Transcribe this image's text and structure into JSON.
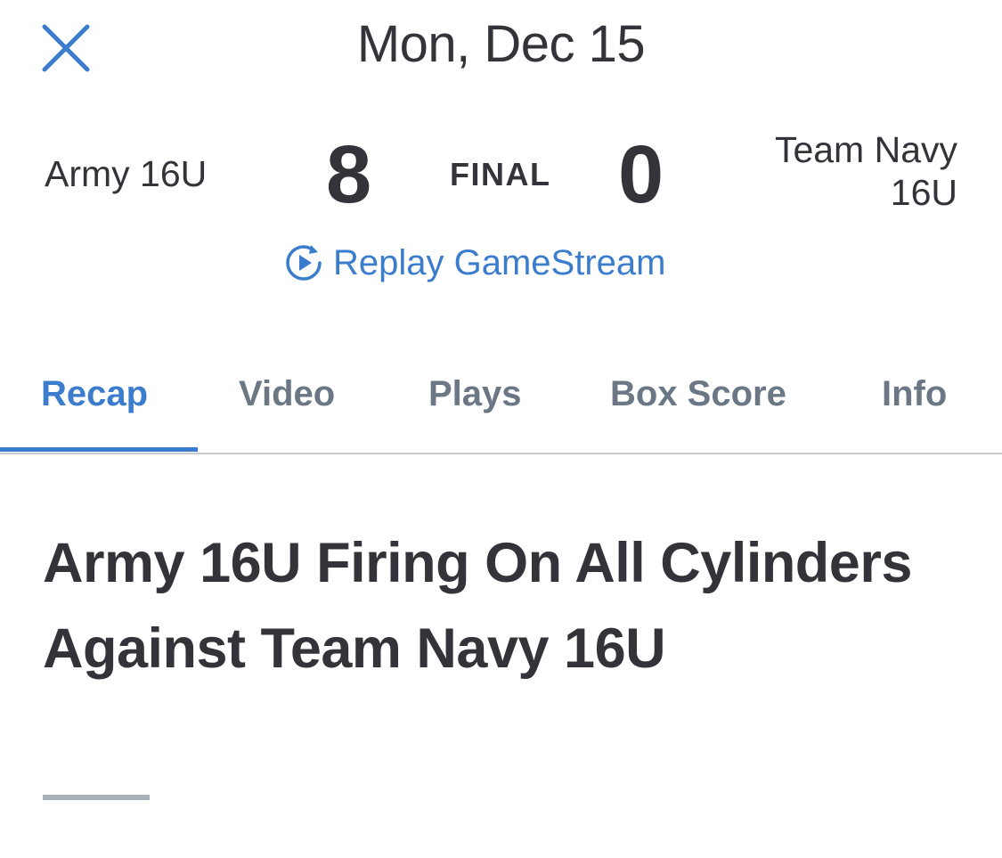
{
  "header": {
    "date": "Mon, Dec 15",
    "close_icon": "close-icon"
  },
  "scoreboard": {
    "home_team": "Army 16U",
    "home_score": "8",
    "status": "FINAL",
    "away_score": "0",
    "away_team_line1": "Team Navy",
    "away_team_line2": "16U"
  },
  "replay": {
    "icon": "replay-play-icon",
    "label": "Replay GameStream"
  },
  "tabs": [
    {
      "label": "Recap",
      "active": true
    },
    {
      "label": "Video",
      "active": false
    },
    {
      "label": "Plays",
      "active": false
    },
    {
      "label": "Box Score",
      "active": false
    },
    {
      "label": "Info",
      "active": false
    }
  ],
  "article": {
    "headline": "Army 16U Firing On All Cylinders Against Team Navy 16U"
  },
  "colors": {
    "accent": "#3b7dcc",
    "text": "#333339",
    "tab_inactive": "#6b7785",
    "divider": "#c8cacd",
    "headline_rule": "#a9b0b8"
  }
}
